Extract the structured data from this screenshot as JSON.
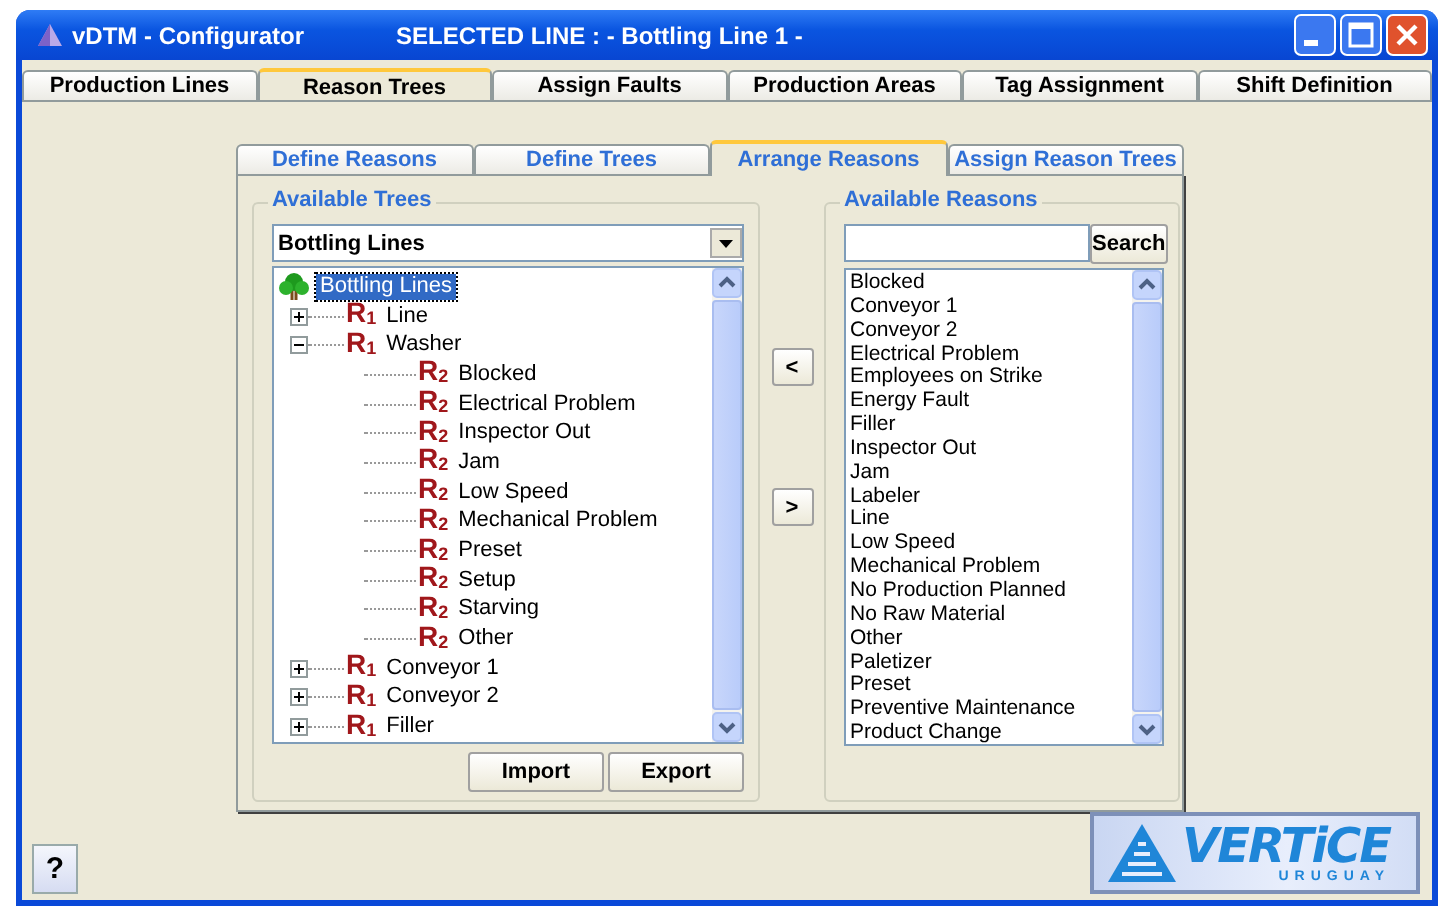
{
  "window": {
    "title": "vDTM - Configurator",
    "subtitle": "SELECTED LINE : - Bottling Line 1 -"
  },
  "tabs": [
    {
      "label": "Production Lines",
      "selected": false
    },
    {
      "label": "Reason Trees",
      "selected": true
    },
    {
      "label": "Assign Faults",
      "selected": false
    },
    {
      "label": "Production  Areas",
      "selected": false
    },
    {
      "label": "Tag Assignment",
      "selected": false
    },
    {
      "label": "Shift Definition",
      "selected": false
    }
  ],
  "subtabs": [
    {
      "label": "Define Reasons",
      "selected": false
    },
    {
      "label": "Define Trees",
      "selected": false
    },
    {
      "label": "Arrange Reasons",
      "selected": true
    },
    {
      "label": "Assign Reason Trees",
      "selected": false
    }
  ],
  "trees_group": {
    "title": "Available Trees",
    "dropdown": "Bottling Lines",
    "tree": [
      {
        "label": "Bottling Lines",
        "kind": "root",
        "selected": true,
        "children": [
          {
            "label": "Line",
            "kind": "reason",
            "badge": "R$_{1}$",
            "selected": false,
            "expanded": false
          },
          {
            "label": "Washer",
            "kind": "reason",
            "badge": "R$_{1}$",
            "selected": false,
            "expanded": true,
            "children": [
              {
                "label": "Blocked",
                "kind": "reason",
                "badge": "R$_{2}$",
                "selected": false
              },
              {
                "label": "Electrical Problem",
                "kind": "reason",
                "badge": "R$_{2}$",
                "selected": false
              },
              {
                "label": "Inspector Out",
                "kind": "reason",
                "badge": "R$_{2}$",
                "selected": false
              },
              {
                "label": "Jam",
                "kind": "reason",
                "badge": "R$_{2}$",
                "selected": false
              },
              {
                "label": "Low Speed",
                "kind": "reason",
                "badge": "R$_{2}$",
                "selected": false
              },
              {
                "label": "Mechanical Problem",
                "kind": "reason",
                "badge": "R$_{2}$",
                "selected": false
              },
              {
                "label": "Preset",
                "kind": "reason",
                "badge": "R$_{2}$",
                "selected": false
              },
              {
                "label": "Setup",
                "kind": "reason",
                "badge": "R$_{2}$",
                "selected": false
              },
              {
                "label": "Starving",
                "kind": "reason",
                "badge": "R$_{2}$",
                "selected": false
              },
              {
                "label": "Other",
                "kind": "reason",
                "badge": "R$_{2}$",
                "selected": false
              }
            ]
          },
          {
            "label": "Conveyor 1",
            "kind": "reason",
            "badge": "R$_{1}$",
            "selected": false,
            "expanded": false
          },
          {
            "label": "Conveyor 2",
            "kind": "reason",
            "badge": "R$_{1}$",
            "selected": false,
            "expanded": false
          },
          {
            "label": "Filler",
            "kind": "reason",
            "badge": "R$_{1}$",
            "selected": false,
            "expanded": false
          }
        ]
      }
    ],
    "buttons": [
      "Import",
      "Export"
    ]
  },
  "move_buttons": [
    "<",
    ">"
  ],
  "reasons_group": {
    "title": "Available Reasons",
    "search_button": "Search",
    "items": [
      "Blocked",
      "Conveyor 1",
      "Conveyor 2",
      "Electrical Problem",
      "Employees on Strike",
      "Energy Fault",
      "Filler",
      "Inspector Out",
      "Jam",
      "Labeler",
      "Line",
      "Low Speed",
      "Mechanical Problem",
      "No Production Planned",
      "No Raw Material",
      "Other",
      "Paletizer",
      "Preset",
      "Preventive Maintenance",
      "Product Change"
    ]
  },
  "help_button": "?",
  "logo": {
    "name": "VERTiCE",
    "tagline": "URUGUAY"
  }
}
